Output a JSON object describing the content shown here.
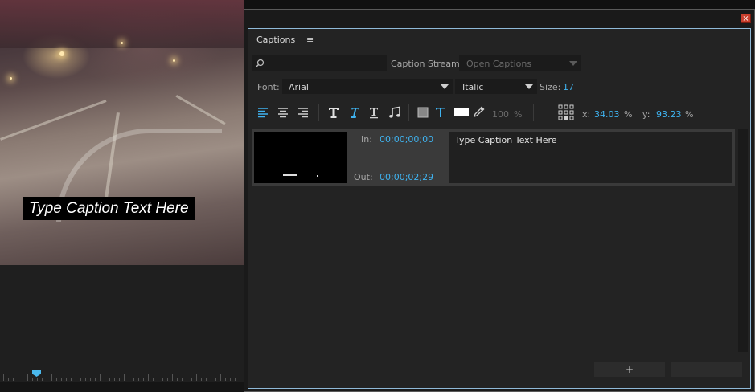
{
  "dialog": {
    "close_symbol": "×",
    "tab_label": "Captions",
    "tab_menu_icon": "≡"
  },
  "search": {
    "placeholder": "",
    "value": ""
  },
  "caption_stream": {
    "label": "Caption Stream:",
    "value": "Open Captions"
  },
  "font": {
    "label": "Font:",
    "value": "Arial"
  },
  "style": {
    "value": "Italic"
  },
  "size": {
    "label": "Size:",
    "value": "17"
  },
  "toolbar": {
    "opacity_value": "100",
    "opacity_unit": "%",
    "x_label": "x:",
    "x_value": "34.03",
    "x_unit": "%",
    "y_label": "y:",
    "y_value": "93.23",
    "y_unit": "%",
    "accent_color": "#3fb3f0"
  },
  "caption_item": {
    "in_label": "In:",
    "in_time": "00;00;00;00",
    "out_label": "Out:",
    "out_time": "00;00;02;29",
    "text": "Type Caption Text Here"
  },
  "video": {
    "overlay_text": "Type Caption Text Here"
  },
  "buttons": {
    "add": "+",
    "remove": "-"
  }
}
